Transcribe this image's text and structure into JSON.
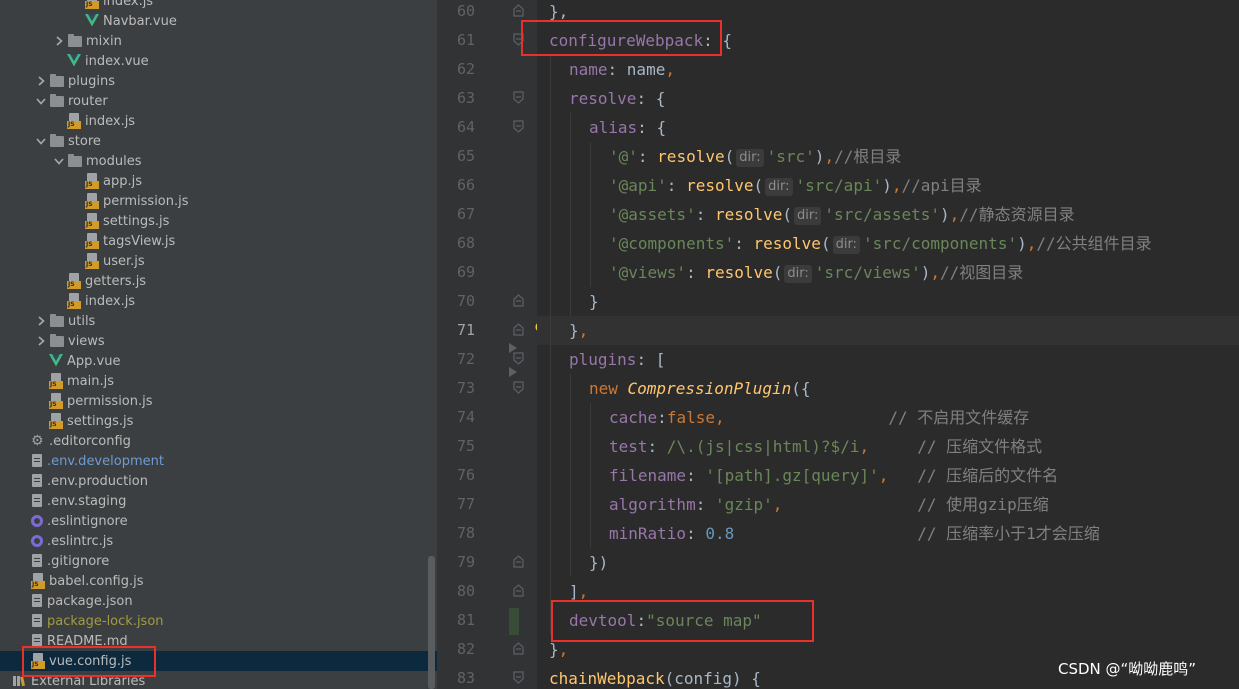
{
  "tree": {
    "rows": [
      {
        "label": "index.js",
        "icon": "js",
        "indent": 3,
        "arrow": ""
      },
      {
        "label": "Navbar.vue",
        "icon": "vue",
        "indent": 3,
        "arrow": ""
      },
      {
        "label": "mixin",
        "icon": "folder",
        "indent": 2,
        "arrow": "right"
      },
      {
        "label": "index.vue",
        "icon": "vue",
        "indent": 2,
        "arrow": ""
      },
      {
        "label": "plugins",
        "icon": "folder",
        "indent": 1,
        "arrow": "right"
      },
      {
        "label": "router",
        "icon": "folder",
        "indent": 1,
        "arrow": "down"
      },
      {
        "label": "index.js",
        "icon": "js",
        "indent": 2,
        "arrow": ""
      },
      {
        "label": "store",
        "icon": "folder",
        "indent": 1,
        "arrow": "down"
      },
      {
        "label": "modules",
        "icon": "folder",
        "indent": 2,
        "arrow": "down"
      },
      {
        "label": "app.js",
        "icon": "js",
        "indent": 3,
        "arrow": ""
      },
      {
        "label": "permission.js",
        "icon": "js",
        "indent": 3,
        "arrow": ""
      },
      {
        "label": "settings.js",
        "icon": "js",
        "indent": 3,
        "arrow": ""
      },
      {
        "label": "tagsView.js",
        "icon": "js",
        "indent": 3,
        "arrow": ""
      },
      {
        "label": "user.js",
        "icon": "js",
        "indent": 3,
        "arrow": ""
      },
      {
        "label": "getters.js",
        "icon": "js",
        "indent": 2,
        "arrow": ""
      },
      {
        "label": "index.js",
        "icon": "js",
        "indent": 2,
        "arrow": ""
      },
      {
        "label": "utils",
        "icon": "folder",
        "indent": 1,
        "arrow": "right"
      },
      {
        "label": "views",
        "icon": "folder",
        "indent": 1,
        "arrow": "right"
      },
      {
        "label": "App.vue",
        "icon": "vue",
        "indent": 1,
        "arrow": ""
      },
      {
        "label": "main.js",
        "icon": "js",
        "indent": 1,
        "arrow": ""
      },
      {
        "label": "permission.js",
        "icon": "js",
        "indent": 1,
        "arrow": ""
      },
      {
        "label": "settings.js",
        "icon": "js",
        "indent": 1,
        "arrow": ""
      },
      {
        "label": ".editorconfig",
        "icon": "gear",
        "indent": 0,
        "arrow": ""
      },
      {
        "label": ".env.development",
        "icon": "file",
        "indent": 0,
        "arrow": "",
        "color": "blue"
      },
      {
        "label": ".env.production",
        "icon": "file",
        "indent": 0,
        "arrow": ""
      },
      {
        "label": ".env.staging",
        "icon": "file",
        "indent": 0,
        "arrow": ""
      },
      {
        "label": ".eslintignore",
        "icon": "ring",
        "indent": 0,
        "arrow": ""
      },
      {
        "label": ".eslintrc.js",
        "icon": "ring",
        "indent": 0,
        "arrow": ""
      },
      {
        "label": ".gitignore",
        "icon": "file",
        "indent": 0,
        "arrow": ""
      },
      {
        "label": "babel.config.js",
        "icon": "js",
        "indent": 0,
        "arrow": ""
      },
      {
        "label": "package.json",
        "icon": "file",
        "indent": 0,
        "arrow": ""
      },
      {
        "label": "package-lock.json",
        "icon": "file",
        "indent": 0,
        "arrow": "",
        "color": "olive"
      },
      {
        "label": "README.md",
        "icon": "file",
        "indent": 0,
        "arrow": ""
      },
      {
        "label": "vue.config.js",
        "icon": "js",
        "indent": 0,
        "arrow": "",
        "selected": true
      },
      {
        "label": "External Libraries",
        "icon": "lib",
        "indent": -1,
        "arrow": ""
      }
    ]
  },
  "editor": {
    "current_line": 71,
    "lines": [
      {
        "n": 60,
        "indent": 0,
        "tokens": [
          [
            "plain",
            "},"
          ]
        ]
      },
      {
        "n": 61,
        "indent": 0,
        "tokens": [
          [
            "prop",
            "configureWebpack"
          ],
          [
            "plain",
            ": {"
          ]
        ]
      },
      {
        "n": 62,
        "indent": 1,
        "tokens": [
          [
            "prop",
            "name"
          ],
          [
            "plain",
            ": name"
          ],
          [
            "kw",
            ","
          ]
        ]
      },
      {
        "n": 63,
        "indent": 1,
        "tokens": [
          [
            "prop",
            "resolve"
          ],
          [
            "plain",
            ": {"
          ]
        ]
      },
      {
        "n": 64,
        "indent": 2,
        "tokens": [
          [
            "prop",
            "alias"
          ],
          [
            "plain",
            ": {"
          ]
        ]
      },
      {
        "n": 65,
        "indent": 3,
        "tokens": [
          [
            "str",
            "'@'"
          ],
          [
            "plain",
            ": "
          ],
          [
            "fn",
            "resolve"
          ],
          [
            "plain",
            "("
          ],
          [
            "hint",
            "dir:"
          ],
          [
            "str",
            "'src'"
          ],
          [
            "plain",
            ")"
          ],
          [
            "kw",
            ","
          ],
          [
            "com",
            "//根目录"
          ]
        ]
      },
      {
        "n": 66,
        "indent": 3,
        "tokens": [
          [
            "str",
            "'@api'"
          ],
          [
            "plain",
            ": "
          ],
          [
            "fn",
            "resolve"
          ],
          [
            "plain",
            "("
          ],
          [
            "hint",
            "dir:"
          ],
          [
            "str",
            "'src/api'"
          ],
          [
            "plain",
            ")"
          ],
          [
            "kw",
            ","
          ],
          [
            "com",
            "//api目录"
          ]
        ]
      },
      {
        "n": 67,
        "indent": 3,
        "tokens": [
          [
            "str",
            "'@assets'"
          ],
          [
            "plain",
            ": "
          ],
          [
            "fn",
            "resolve"
          ],
          [
            "plain",
            "("
          ],
          [
            "hint",
            "dir:"
          ],
          [
            "str",
            "'src/assets'"
          ],
          [
            "plain",
            ")"
          ],
          [
            "kw",
            ","
          ],
          [
            "com",
            "//静态资源目录"
          ]
        ]
      },
      {
        "n": 68,
        "indent": 3,
        "tokens": [
          [
            "str",
            "'@components'"
          ],
          [
            "plain",
            ": "
          ],
          [
            "fn",
            "resolve"
          ],
          [
            "plain",
            "("
          ],
          [
            "hint",
            "dir:"
          ],
          [
            "str",
            "'src/components'"
          ],
          [
            "plain",
            ")"
          ],
          [
            "kw",
            ","
          ],
          [
            "com",
            "//公共组件目录"
          ]
        ]
      },
      {
        "n": 69,
        "indent": 3,
        "tokens": [
          [
            "str",
            "'@views'"
          ],
          [
            "plain",
            ": "
          ],
          [
            "fn",
            "resolve"
          ],
          [
            "plain",
            "("
          ],
          [
            "hint",
            "dir:"
          ],
          [
            "str",
            "'src/views'"
          ],
          [
            "plain",
            ")"
          ],
          [
            "kw",
            ","
          ],
          [
            "com",
            "//视图目录"
          ]
        ]
      },
      {
        "n": 70,
        "indent": 2,
        "tokens": [
          [
            "plain",
            "}"
          ]
        ]
      },
      {
        "n": 71,
        "indent": 1,
        "tokens": [
          [
            "plain",
            "}"
          ],
          [
            "kw",
            ","
          ]
        ]
      },
      {
        "n": 72,
        "indent": 1,
        "tokens": [
          [
            "prop",
            "plugins"
          ],
          [
            "plain",
            ": ["
          ]
        ]
      },
      {
        "n": 73,
        "indent": 2,
        "tokens": [
          [
            "kw",
            "new "
          ],
          [
            "cls",
            "CompressionPlugin"
          ],
          [
            "plain",
            "({"
          ]
        ]
      },
      {
        "n": 74,
        "indent": 3,
        "tokens": [
          [
            "prop",
            "cache"
          ],
          [
            "plain",
            ":"
          ],
          [
            "kw",
            "false,"
          ],
          [
            "plain",
            "                 "
          ],
          [
            "com",
            "// 不启用文件缓存"
          ]
        ]
      },
      {
        "n": 75,
        "indent": 3,
        "tokens": [
          [
            "prop",
            "test"
          ],
          [
            "plain",
            ": "
          ],
          [
            "reb",
            "/\\.(js|css|html)?$/i"
          ],
          [
            "kw",
            ","
          ],
          [
            "plain",
            "     "
          ],
          [
            "com",
            "// 压缩文件格式"
          ]
        ]
      },
      {
        "n": 76,
        "indent": 3,
        "tokens": [
          [
            "prop",
            "filename"
          ],
          [
            "plain",
            ": "
          ],
          [
            "str",
            "'[path].gz[query]'"
          ],
          [
            "kw",
            ","
          ],
          [
            "plain",
            "   "
          ],
          [
            "com",
            "// 压缩后的文件名"
          ]
        ]
      },
      {
        "n": 77,
        "indent": 3,
        "tokens": [
          [
            "prop",
            "algorithm"
          ],
          [
            "plain",
            ": "
          ],
          [
            "str",
            "'gzip'"
          ],
          [
            "kw",
            ","
          ],
          [
            "plain",
            "              "
          ],
          [
            "com",
            "// 使用gzip压缩"
          ]
        ]
      },
      {
        "n": 78,
        "indent": 3,
        "tokens": [
          [
            "prop",
            "minRatio"
          ],
          [
            "plain",
            ": "
          ],
          [
            "num",
            "0.8"
          ],
          [
            "plain",
            "                   "
          ],
          [
            "com",
            "// 压缩率小于1才会压缩"
          ]
        ]
      },
      {
        "n": 79,
        "indent": 2,
        "tokens": [
          [
            "plain",
            "})"
          ]
        ]
      },
      {
        "n": 80,
        "indent": 1,
        "tokens": [
          [
            "plain",
            "]"
          ],
          [
            "kw",
            ","
          ]
        ]
      },
      {
        "n": 81,
        "indent": 1,
        "tokens": [
          [
            "prop",
            "devtool"
          ],
          [
            "plain",
            ":"
          ],
          [
            "str",
            "\"source map\""
          ]
        ]
      },
      {
        "n": 82,
        "indent": 0,
        "tokens": [
          [
            "plain",
            "}"
          ],
          [
            "kw",
            ","
          ]
        ]
      },
      {
        "n": 83,
        "indent": 0,
        "tokens": [
          [
            "fn",
            "chainWebpack"
          ],
          [
            "plain",
            "(config) {"
          ]
        ]
      }
    ]
  },
  "watermark": "CSDN @“呦呦鹿鸣”",
  "colors": {
    "highlight_box": "#e8312a",
    "sidebar_bg": "#3c3f41",
    "editor_bg": "#2b2b2b"
  }
}
